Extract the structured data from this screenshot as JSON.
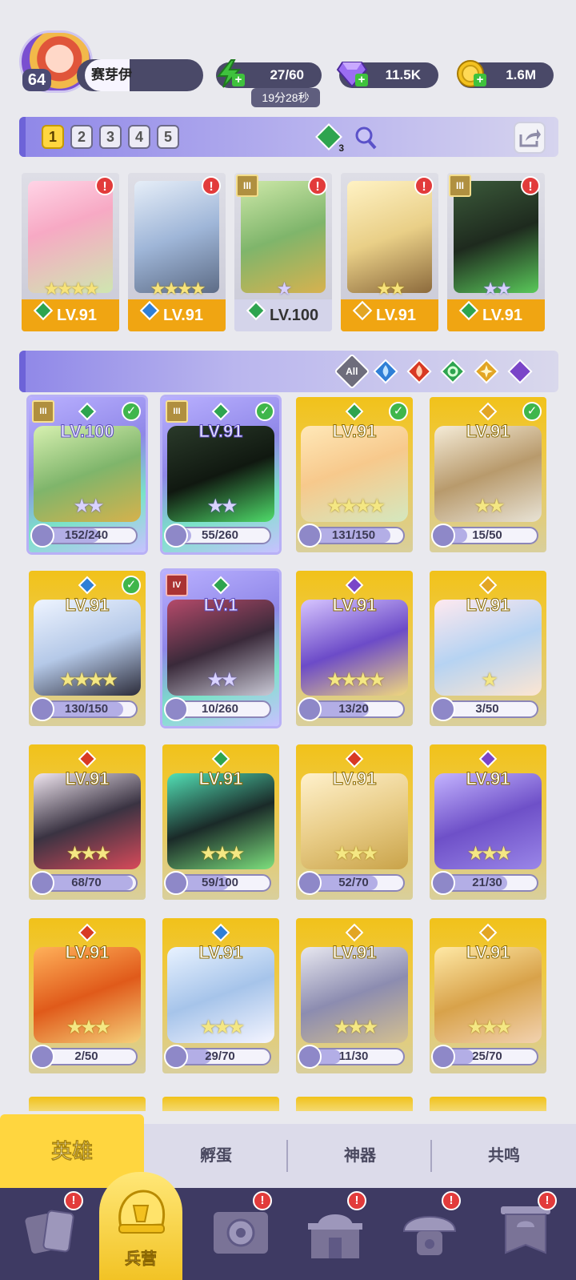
{
  "player": {
    "level": "64",
    "name": "赛芽伊"
  },
  "resources": {
    "energy": "27/60",
    "energy_timer": "19分28秒",
    "gems": "11.5K",
    "gold": "1.6M"
  },
  "team": {
    "tabs": [
      "1",
      "2",
      "3",
      "4",
      "5"
    ],
    "active_tab": "1",
    "energy_badge": "3",
    "slots": [
      {
        "level": "LV.91",
        "element": "wind",
        "stars": "★★★★",
        "star_color": "gold",
        "alert": "!",
        "tier": ""
      },
      {
        "level": "LV.91",
        "element": "water",
        "stars": "★★★★",
        "star_color": "gold",
        "alert": "!",
        "tier": ""
      },
      {
        "level": "LV.100",
        "element": "wind",
        "stars": "★",
        "star_color": "purple",
        "alert": "!",
        "tier": "III"
      },
      {
        "level": "LV.91",
        "element": "light",
        "stars": "★★",
        "star_color": "gold",
        "alert": "!",
        "tier": ""
      },
      {
        "level": "LV.91",
        "element": "wind",
        "stars": "★★",
        "star_color": "purple",
        "alert": "!",
        "tier": "III"
      }
    ]
  },
  "filters": {
    "all_label": "All",
    "elements": [
      "water",
      "fire",
      "wind",
      "light",
      "dark"
    ]
  },
  "heroes": [
    {
      "level": "LV.100",
      "shards": "152/240",
      "fill": 0.63,
      "stars": "★★",
      "rarity": "purple",
      "element": "wind",
      "tier": "III",
      "check": true
    },
    {
      "level": "LV.91",
      "shards": "55/260",
      "fill": 0.21,
      "stars": "★★",
      "rarity": "purple",
      "element": "wind",
      "tier": "III",
      "check": true
    },
    {
      "level": "LV.91",
      "shards": "131/150",
      "fill": 0.87,
      "stars": "★★★★",
      "rarity": "gold",
      "element": "wind",
      "tier": "",
      "check": true
    },
    {
      "level": "LV.91",
      "shards": "15/50",
      "fill": 0.3,
      "stars": "★★",
      "rarity": "gold",
      "element": "light",
      "tier": "",
      "check": true
    },
    {
      "level": "LV.91",
      "shards": "130/150",
      "fill": 0.87,
      "stars": "★★★★",
      "rarity": "gold",
      "element": "water",
      "tier": "",
      "check": true
    },
    {
      "level": "LV.1",
      "shards": "10/260",
      "fill": 0.04,
      "stars": "★★",
      "rarity": "purple",
      "element": "wind",
      "tier": "IV",
      "check": false
    },
    {
      "level": "LV.91",
      "shards": "13/20",
      "fill": 0.65,
      "stars": "★★★★",
      "rarity": "gold",
      "element": "dark",
      "tier": "",
      "check": false
    },
    {
      "level": "LV.91",
      "shards": "3/50",
      "fill": 0.06,
      "stars": "★",
      "rarity": "gold",
      "element": "light",
      "tier": "",
      "check": false
    },
    {
      "level": "LV.91",
      "shards": "68/70",
      "fill": 0.97,
      "stars": "★★★",
      "rarity": "gold",
      "element": "fire",
      "tier": "",
      "check": false
    },
    {
      "level": "LV.91",
      "shards": "59/100",
      "fill": 0.59,
      "stars": "★★★",
      "rarity": "gold",
      "element": "wind",
      "tier": "",
      "check": false
    },
    {
      "level": "LV.91",
      "shards": "52/70",
      "fill": 0.74,
      "stars": "★★★",
      "rarity": "gold",
      "element": "fire",
      "tier": "",
      "check": false
    },
    {
      "level": "LV.91",
      "shards": "21/30",
      "fill": 0.7,
      "stars": "★★★",
      "rarity": "gold",
      "element": "dark",
      "tier": "",
      "check": false
    },
    {
      "level": "LV.91",
      "shards": "2/50",
      "fill": 0.04,
      "stars": "★★★",
      "rarity": "gold",
      "element": "fire",
      "tier": "",
      "check": false
    },
    {
      "level": "LV.91",
      "shards": "29/70",
      "fill": 0.41,
      "stars": "★★★",
      "rarity": "gold",
      "element": "water",
      "tier": "",
      "check": false
    },
    {
      "level": "LV.91",
      "shards": "11/30",
      "fill": 0.37,
      "stars": "★★★",
      "rarity": "gold",
      "element": "light",
      "tier": "",
      "check": false
    },
    {
      "level": "LV.91",
      "shards": "25/70",
      "fill": 0.36,
      "stars": "★★★",
      "rarity": "gold",
      "element": "light",
      "tier": "",
      "check": false
    }
  ],
  "sub_tabs": [
    "英雄",
    "孵蛋",
    "神器",
    "共鸣"
  ],
  "bottom_nav": {
    "active_label": "兵营",
    "alert": "!"
  },
  "colors": {
    "accent": "#8f87e8",
    "gold": "#f1c21a",
    "nav_bg": "#3e3a63",
    "element_water": "#2f7fd6",
    "element_fire": "#d83a24",
    "element_wind": "#2ea44f",
    "element_light": "#e2a524",
    "element_dark": "#7a45c8"
  }
}
